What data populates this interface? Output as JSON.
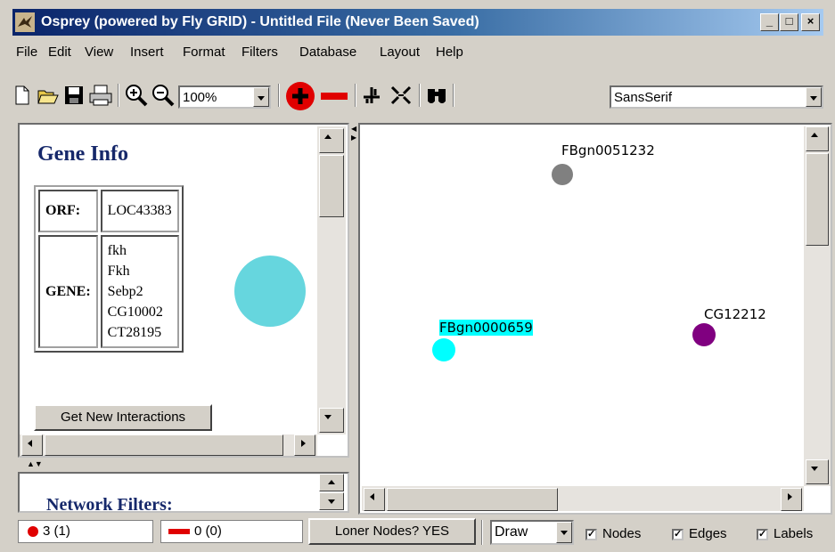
{
  "window": {
    "title": "Osprey (powered by Fly GRID) - Untitled File (Never Been Saved)",
    "controls": [
      "_",
      "□",
      "×"
    ]
  },
  "menu": [
    "File",
    "Edit",
    "View",
    "Insert",
    "Format",
    "Filters",
    "Database",
    "Layout",
    "Help"
  ],
  "toolbar": {
    "zoom": "100%",
    "font": "SansSerif",
    "icons": [
      "new-file-icon",
      "open-folder-icon",
      "save-icon",
      "print-icon",
      "zoom-in-icon",
      "zoom-out-icon",
      "add-node-icon",
      "remove-node-icon",
      "move-icon",
      "fit-icon",
      "find-icon"
    ]
  },
  "gene_info": {
    "title": "Gene Info",
    "orf_label": "ORF:",
    "orf_value": "LOC43383",
    "gene_label": "GENE:",
    "gene_values": [
      "fkh",
      "Fkh",
      "Sebp2",
      "CG10002",
      "CT28195"
    ],
    "node_color": "#66d6de",
    "button": "Get New Interactions"
  },
  "filters": {
    "title": "Network Filters:"
  },
  "graph": {
    "nodes": [
      {
        "label": "FBgn0051232",
        "color": "#808080"
      },
      {
        "label": "FBgn0000659",
        "color": "#00ffff",
        "selected": true
      },
      {
        "label": "CG12212",
        "color": "#800080"
      }
    ]
  },
  "status": {
    "nodes_count": "3 (1)",
    "edges_count": "0 (0)",
    "loner_button": "Loner Nodes? YES",
    "mode": "Draw",
    "checks": [
      {
        "label": "Nodes",
        "checked": true
      },
      {
        "label": "Edges",
        "checked": true
      },
      {
        "label": "Labels",
        "checked": true
      }
    ]
  }
}
